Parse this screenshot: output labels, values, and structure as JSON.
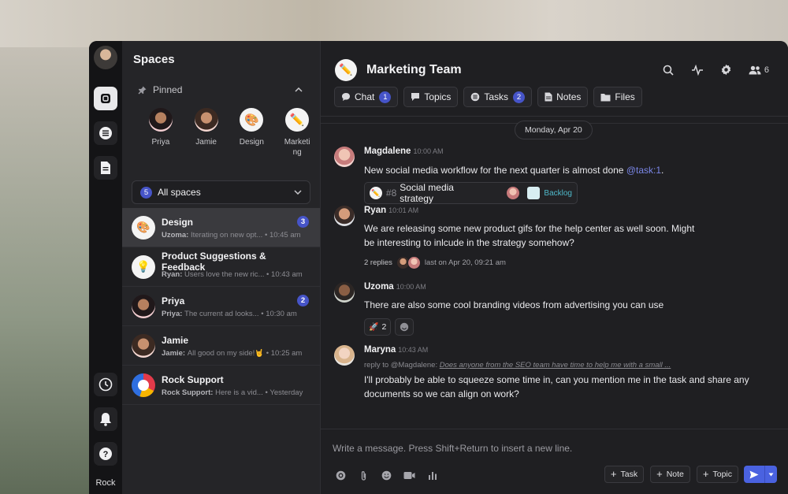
{
  "rail": {
    "bottom_label": "Rock"
  },
  "spaces": {
    "title": "Spaces",
    "pinned_label": "Pinned",
    "pinned": [
      {
        "name": "Priya",
        "icon": "person-avatar"
      },
      {
        "name": "Jamie",
        "icon": "person-avatar"
      },
      {
        "name": "Design",
        "icon": "palette-icon"
      },
      {
        "name": "Marketing",
        "icon": "pencil-icon"
      }
    ],
    "all_spaces_count": "5",
    "all_spaces_label": "All spaces",
    "items": [
      {
        "name": "Design",
        "sender": "Uzoma:",
        "snippet": "Iterating on new opt...",
        "time": "10:45 am",
        "badge": "3",
        "icon": "palette-icon"
      },
      {
        "name": "Product Suggestions & Feedback",
        "sender": "Ryan:",
        "snippet": "Users love the new ric...",
        "time": "10:43 am",
        "badge": "",
        "icon": "bulb-icon"
      },
      {
        "name": "Priya",
        "sender": "Priya:",
        "snippet": "The current ad looks...",
        "time": "10:30 am",
        "badge": "2",
        "icon": "person-avatar"
      },
      {
        "name": "Jamie",
        "sender": "Jamie:",
        "snippet": "All good on my side!🤘",
        "time": "10:25 am",
        "badge": "",
        "icon": "person-avatar"
      },
      {
        "name": "Rock Support",
        "sender": "Rock Support:",
        "snippet": "Here is a vid...",
        "time": "Yesterday",
        "badge": "",
        "icon": "rock-logo"
      }
    ]
  },
  "chat": {
    "title": "Marketing Team",
    "member_count": "6",
    "tabs": [
      {
        "label": "Chat",
        "badge": "1"
      },
      {
        "label": "Topics",
        "badge": ""
      },
      {
        "label": "Tasks",
        "badge": "2"
      },
      {
        "label": "Notes",
        "badge": ""
      },
      {
        "label": "Files",
        "badge": ""
      }
    ],
    "date_divider": "Monday, Apr 20",
    "messages": [
      {
        "author": "Magdalene",
        "time": "10:00 AM",
        "text": "New social media workflow for the next quarter is almost done ",
        "mention": "@task:1",
        "text_end": ".",
        "task": {
          "number": "#8",
          "title": "Social media strategy",
          "status": "Backlog"
        }
      },
      {
        "author": "Ryan",
        "time": "10:01 AM",
        "text": "We are releasing some new product gifs for the help center as well soon. Might be interesting to inlcude in the strategy somehow?",
        "replies": "2 replies",
        "last_reply": "last on Apr 20, 09:21 am"
      },
      {
        "author": "Uzoma",
        "time": "10:00 AM",
        "text": "There are also some cool branding videos from advertising you can use",
        "reaction_count": "2"
      },
      {
        "author": "Maryna",
        "time": "10:43 AM",
        "reply_prefix": "reply to @Magdalene:",
        "reply_quote": "Does anyone from the SEO team have time to help me with a small ...",
        "text": "I'll probably be able to squeeze some time in, can you mention me in the task and share any documents so we can align on work?"
      }
    ],
    "composer": {
      "placeholder": "Write a message. Press Shift+Return to insert a new line.",
      "task_label": "Task",
      "note_label": "Note",
      "topic_label": "Topic"
    }
  },
  "colors": {
    "accent": "#4654c8",
    "send": "#4a62e0",
    "mention": "#7a86e6",
    "backlog": "#4fb8c9"
  }
}
